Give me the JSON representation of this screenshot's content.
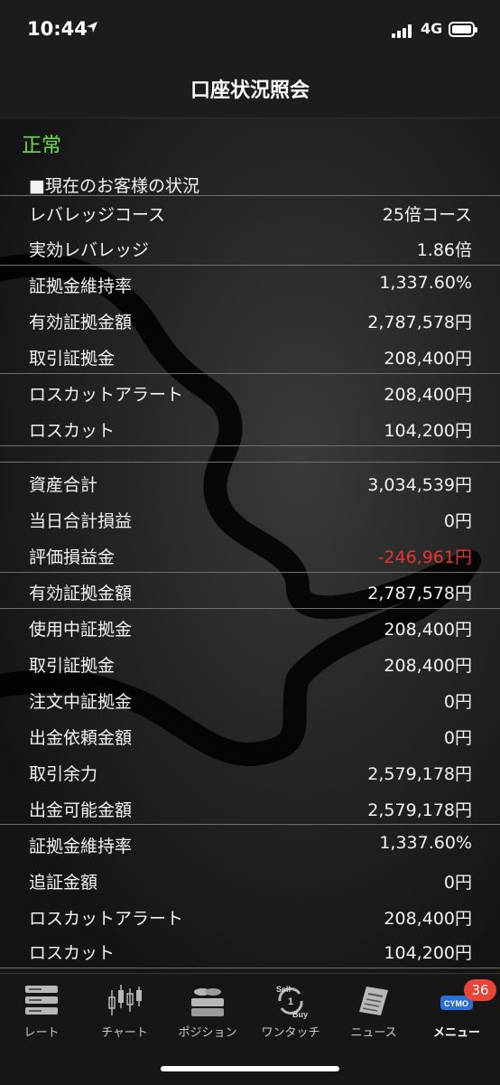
{
  "status_bar": {
    "time": "10:44",
    "network": "4G"
  },
  "header": {
    "title": "口座状況照会"
  },
  "account_status": "正常",
  "section_title": "■現在のお客様の状況",
  "rows": [
    {
      "label": "レバレッジコース",
      "value": "25倍コース"
    },
    {
      "label": "実効レバレッジ",
      "value": "1.86倍"
    },
    {
      "label": "証拠金維持率",
      "value": "1,337.60%"
    },
    {
      "label": "有効証拠金額",
      "value": "2,787,578円"
    },
    {
      "label": "取引証拠金",
      "value": "208,400円"
    },
    {
      "label": "ロスカットアラート",
      "value": "208,400円"
    },
    {
      "label": "ロスカット",
      "value": "104,200円"
    },
    {
      "label": "資産合計",
      "value": "3,034,539円"
    },
    {
      "label": "当日合計損益",
      "value": "0円"
    },
    {
      "label": "評価損益金",
      "value": "-246,961円"
    },
    {
      "label": "有効証拠金額",
      "value": "2,787,578円"
    },
    {
      "label": "使用中証拠金",
      "value": "208,400円"
    },
    {
      "label": "取引証拠金",
      "value": "208,400円"
    },
    {
      "label": "注文中証拠金",
      "value": "0円"
    },
    {
      "label": "出金依頼金額",
      "value": "0円"
    },
    {
      "label": "取引余力",
      "value": "2,579,178円"
    },
    {
      "label": "出金可能金額",
      "value": "2,579,178円"
    },
    {
      "label": "証拠金維持率",
      "value": "1,337.60%"
    },
    {
      "label": "追証金額",
      "value": "0円"
    },
    {
      "label": "ロスカットアラート",
      "value": "208,400円"
    },
    {
      "label": "ロスカット",
      "value": "104,200円"
    }
  ],
  "colors": {
    "positive_status": "#6cdc54",
    "negative_value": "#e8352f",
    "badge": "#e8443a"
  },
  "tab_bar": {
    "tabs": [
      {
        "label": "レート",
        "icon": "server-stack-icon"
      },
      {
        "label": "チャート",
        "icon": "candlestick-chart-icon"
      },
      {
        "label": "ポジション",
        "icon": "coins-icon"
      },
      {
        "label": "ワンタッチ",
        "icon": "sell-buy-icon"
      },
      {
        "label": "ニュース",
        "icon": "newspaper-icon"
      },
      {
        "label": "メニュー",
        "icon": "cymo-logo-icon"
      }
    ],
    "active": "メニュー",
    "menu_badge": "36"
  },
  "icon_texts": {
    "sell": "Sell",
    "buy": "Buy",
    "one": "1",
    "cymo": "CYMO"
  }
}
